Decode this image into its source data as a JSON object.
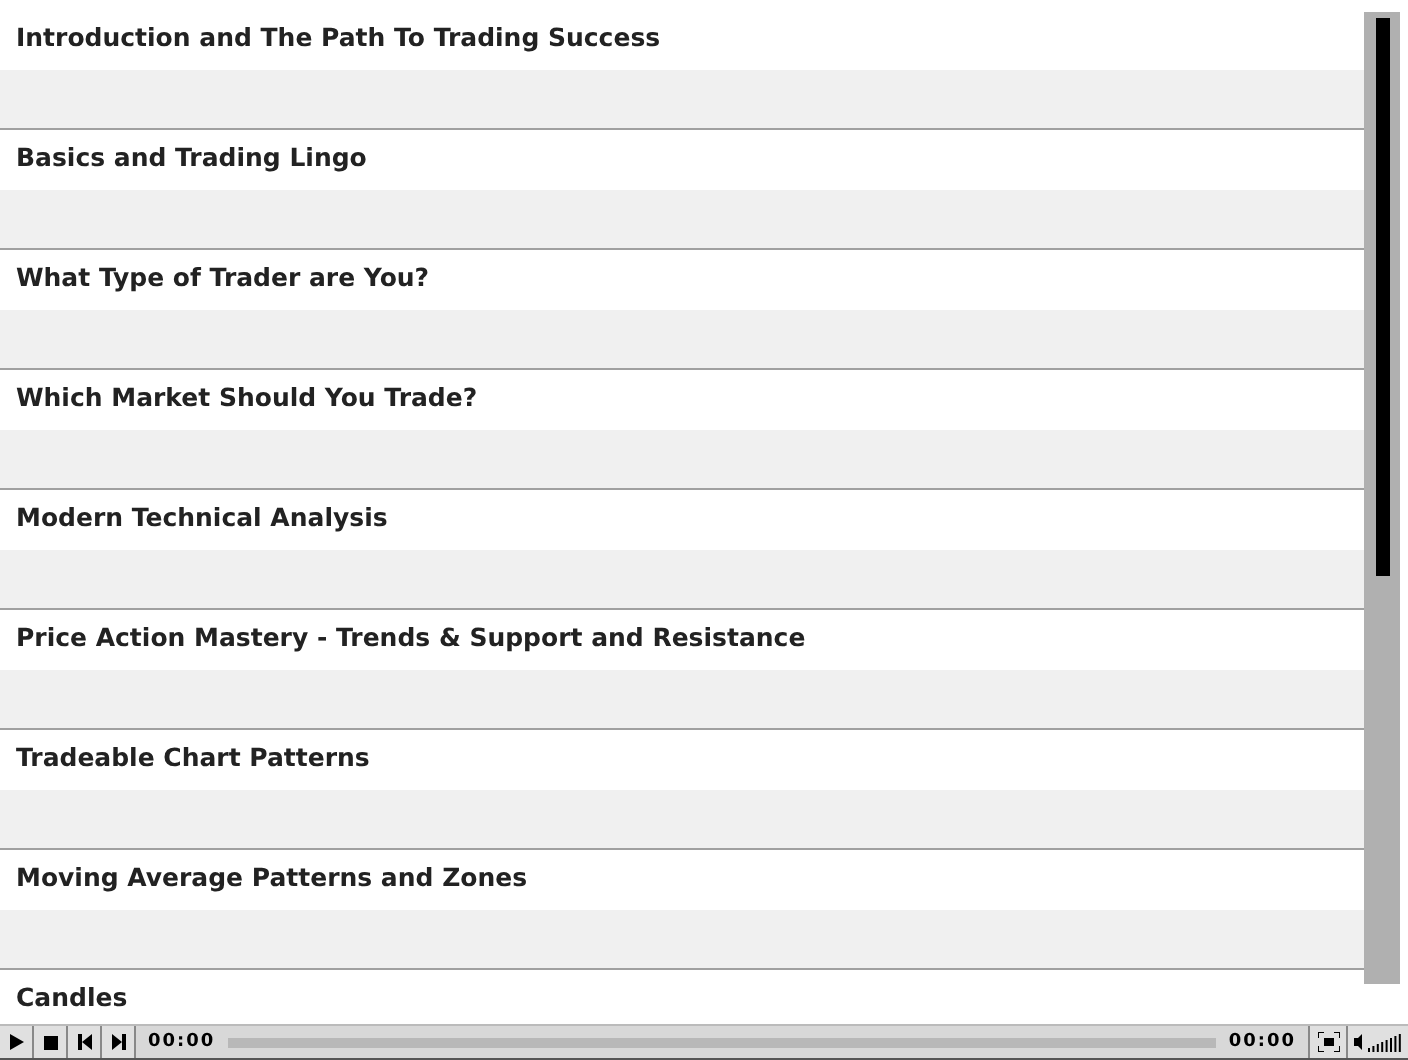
{
  "lessons": [
    {
      "title": "Introduction and The Path To Trading Success"
    },
    {
      "title": "Basics and Trading Lingo"
    },
    {
      "title": "What Type of Trader are You?"
    },
    {
      "title": "Which Market Should You Trade?"
    },
    {
      "title": "Modern Technical Analysis"
    },
    {
      "title": "Price Action Mastery - Trends & Support and Resistance"
    },
    {
      "title": "Tradeable Chart Patterns"
    },
    {
      "title": "Moving Average Patterns and Zones"
    },
    {
      "title": "Candles"
    }
  ],
  "player": {
    "elapsed": "00:00",
    "duration": "00:00",
    "progress": {
      "level": 0
    }
  }
}
